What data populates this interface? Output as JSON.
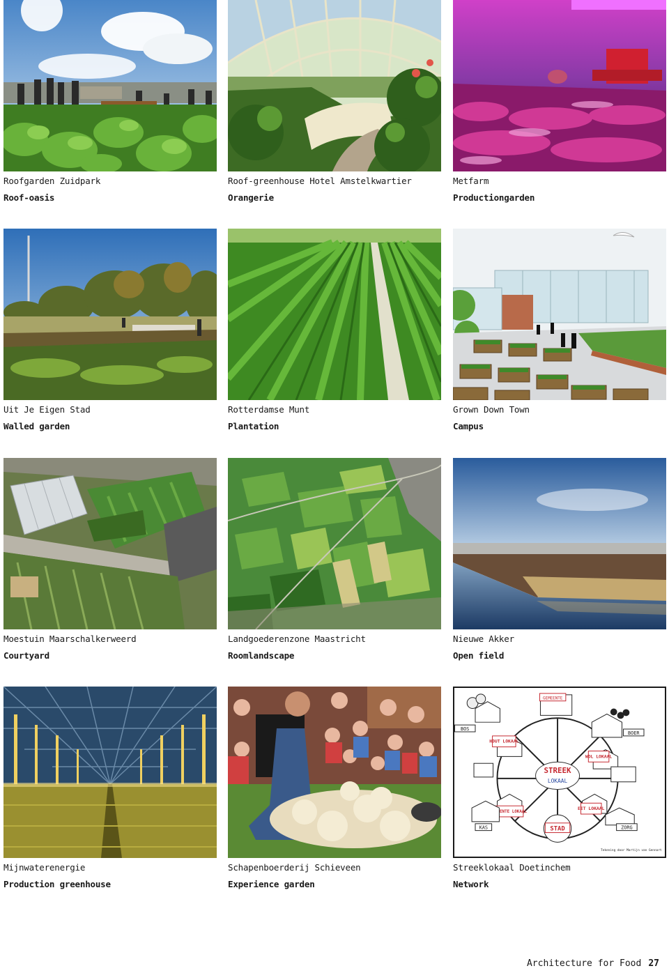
{
  "cards": [
    {
      "name": "Roofgarden Zuidpark",
      "typology": "Roof-oasis"
    },
    {
      "name": "Roof-greenhouse Hotel Amstelkwartier",
      "typology": "Orangerie"
    },
    {
      "name": "Metfarm",
      "typology": "Productiongarden"
    },
    {
      "name": "Uit Je Eigen Stad",
      "typology": "Walled garden"
    },
    {
      "name": "Rotterdamse Munt",
      "typology": "Plantation"
    },
    {
      "name": "Grown Down Town",
      "typology": "Campus"
    },
    {
      "name": "Moestuin Maarschalkerweerd",
      "typology": "Courtyard"
    },
    {
      "name": "Landgoederenzone Maastricht",
      "typology": "Roomlandscape"
    },
    {
      "name": "Nieuwe Akker",
      "typology": "Open field"
    },
    {
      "name": "Mijnwaterenergie",
      "typology": "Production greenhouse"
    },
    {
      "name": "Schapenboerderij Schieveen",
      "typology": "Experience garden"
    },
    {
      "name": "Streeklokaal Doetinchem",
      "typology": "Network"
    }
  ],
  "network_diagram": {
    "center_top": "STREEK",
    "center_bottom": "LOKAAL",
    "labels": [
      "GEMEENTE",
      "BOS",
      "BOER",
      "HOUT LOKAAL",
      "WOL LOKAAL",
      "GROENTE LOKAAL",
      "EET LOKAAL",
      "STAD",
      "KAS",
      "ZORG"
    ],
    "credit": "Tekening door Martijn van Gennart"
  },
  "footer": {
    "title": "Architecture for Food",
    "page": "27"
  },
  "colors": {
    "text": "#1a1a1a",
    "background": "#ffffff"
  }
}
